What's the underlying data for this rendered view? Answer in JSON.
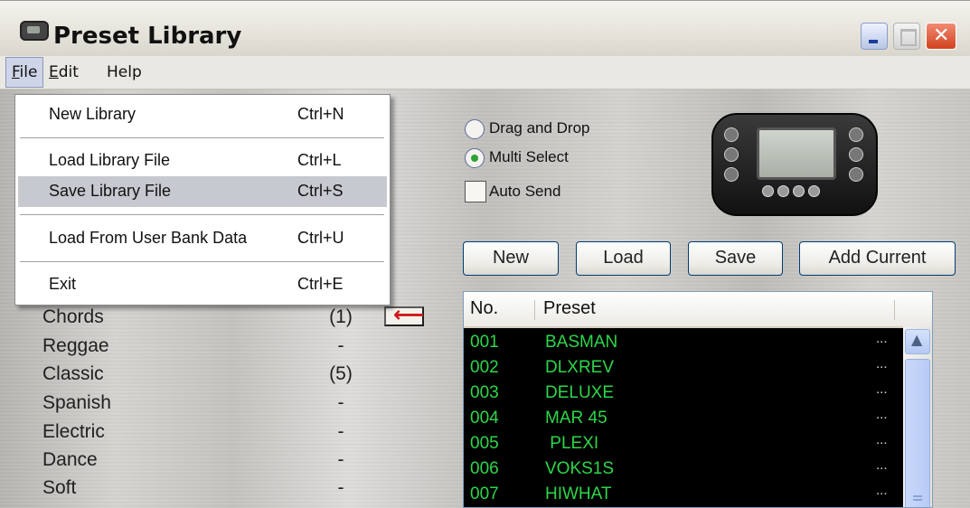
{
  "window": {
    "title": "Preset Library"
  },
  "menubar": {
    "file": "File",
    "file_rest": "ile",
    "file_accel": "F",
    "edit": "Edit",
    "edit_accel": "E",
    "edit_rest": "dit",
    "help": "Help"
  },
  "file_menu": {
    "items": [
      {
        "label": "New Library",
        "shortcut": "Ctrl+N"
      },
      {
        "label": "Load Library File",
        "shortcut": "Ctrl+L"
      },
      {
        "label": "Save Library File",
        "shortcut": "Ctrl+S",
        "highlighted": true
      },
      {
        "label": "Load From User Bank Data",
        "shortcut": "Ctrl+U"
      },
      {
        "label": "Exit",
        "shortcut": "Ctrl+E"
      }
    ]
  },
  "categories": [
    {
      "name": "Chords",
      "count": "(1)"
    },
    {
      "name": "Reggae",
      "count": "-"
    },
    {
      "name": "Classic",
      "count": "(5)"
    },
    {
      "name": "Spanish",
      "count": "-"
    },
    {
      "name": "Electric",
      "count": "-"
    },
    {
      "name": "Dance",
      "count": "-"
    },
    {
      "name": "Soft",
      "count": "-"
    }
  ],
  "options": {
    "drag_drop": "Drag and Drop",
    "multi_select": "Multi Select",
    "auto_send": "Auto Send",
    "selected_mode": "Multi Select",
    "auto_send_checked": false
  },
  "buttons": {
    "new": "New",
    "load": "Load",
    "save": "Save",
    "add_current": "Add Current"
  },
  "preset_list": {
    "columns": {
      "no": "No.",
      "preset": "Preset"
    },
    "rows": [
      {
        "no": "001",
        "name": "BASMAN",
        "dots": "..."
      },
      {
        "no": "002",
        "name": "DLXREV",
        "dots": "..."
      },
      {
        "no": "003",
        "name": "DELUXE",
        "dots": "..."
      },
      {
        "no": "004",
        "name": "MAR 45",
        "dots": "..."
      },
      {
        "no": "005",
        "name": " PLEXI",
        "dots": "..."
      },
      {
        "no": "006",
        "name": "VOKS1S",
        "dots": "..."
      },
      {
        "no": "007",
        "name": "HIWHAT",
        "dots": "..."
      }
    ],
    "text_color": "#2dd64a",
    "background": "#000000"
  },
  "icons": {
    "app": "amp-device-icon",
    "arrow": "left-arrow-icon",
    "minimize": "minimize-icon",
    "maximize": "maximize-icon",
    "close": "close-icon",
    "scroll_up": "chevron-up-icon"
  }
}
